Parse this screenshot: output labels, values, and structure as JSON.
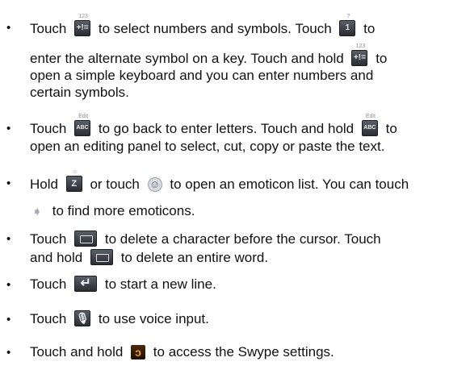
{
  "bullet": "•",
  "items": [
    {
      "lines": [
        "Touch",
        "to select numbers and symbols. Touch",
        "to"
      ],
      "line2": [
        "enter the alternate symbol on a key. Touch and hold",
        "to"
      ],
      "line3": "open a simple keyboard and you can enter numbers and",
      "line4": "certain symbols."
    },
    {
      "line1": [
        "Touch",
        "to go back to enter letters. Touch and hold",
        "to"
      ],
      "line2": "open an editing panel to select, cut, copy or paste the text."
    },
    {
      "line1": [
        "Hold",
        "or touch",
        "to open an emoticon list. You can touch"
      ],
      "line2": "to find more emoticons."
    },
    {
      "line1": [
        "Touch",
        "to delete a character before the cursor. Touch"
      ],
      "line2": [
        "and hold",
        "to delete an entire word."
      ]
    },
    {
      "line1": [
        "Touch",
        "to start a new line."
      ]
    },
    {
      "line1": [
        "Touch",
        "to use voice input."
      ]
    },
    {
      "line1": [
        "Touch and hold",
        "to access the Swype settings."
      ]
    }
  ],
  "icons": {
    "sym_super": "123",
    "sym_glyph": "+!=",
    "alt_super": "?",
    "alt_glyph": "1",
    "abc_super": "Edit",
    "abc_glyph": "ABC",
    "z_super": "☺",
    "z_glyph": "Z",
    "smile_glyph": "☺",
    "next_glyph": "➧",
    "enter_glyph": "↵",
    "mic_glyph": "🎙",
    "swype_glyph": "ↄ"
  }
}
